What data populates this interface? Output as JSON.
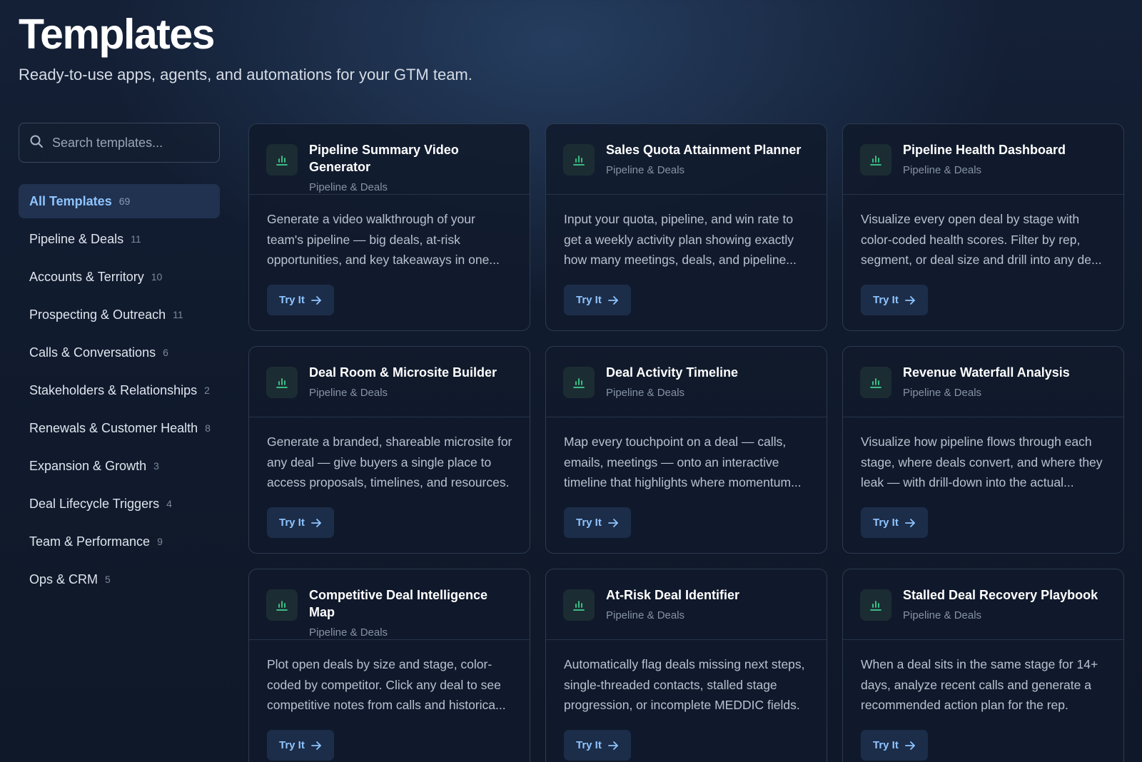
{
  "header": {
    "title": "Templates",
    "subtitle": "Ready-to-use apps, agents, and automations for your GTM team."
  },
  "search": {
    "placeholder": "Search templates...",
    "value": ""
  },
  "sidebar": {
    "items": [
      {
        "label": "All Templates",
        "count": "69",
        "active": true
      },
      {
        "label": "Pipeline & Deals",
        "count": "11"
      },
      {
        "label": "Accounts & Territory",
        "count": "10"
      },
      {
        "label": "Prospecting & Outreach",
        "count": "11"
      },
      {
        "label": "Calls & Conversations",
        "count": "6"
      },
      {
        "label": "Stakeholders & Relationships",
        "count": "2"
      },
      {
        "label": "Renewals & Customer Health",
        "count": "8"
      },
      {
        "label": "Expansion & Growth",
        "count": "3"
      },
      {
        "label": "Deal Lifecycle Triggers",
        "count": "4"
      },
      {
        "label": "Team & Performance",
        "count": "9"
      },
      {
        "label": "Ops & CRM",
        "count": "5"
      }
    ]
  },
  "cards": [
    {
      "title": "Pipeline Summary Video Generator",
      "category": "Pipeline & Deals",
      "description": "Generate a video walkthrough of your team's pipeline — big deals, at-risk opportunities, and key takeaways in one...",
      "button": "Try It"
    },
    {
      "title": "Sales Quota Attainment Planner",
      "category": "Pipeline & Deals",
      "description": "Input your quota, pipeline, and win rate to get a weekly activity plan showing exactly how many meetings, deals, and pipeline...",
      "button": "Try It"
    },
    {
      "title": "Pipeline Health Dashboard",
      "category": "Pipeline & Deals",
      "description": "Visualize every open deal by stage with color-coded health scores. Filter by rep, segment, or deal size and drill into any de...",
      "button": "Try It"
    },
    {
      "title": "Deal Room & Microsite Builder",
      "category": "Pipeline & Deals",
      "description": "Generate a branded, shareable microsite for any deal — give buyers a single place to access proposals, timelines, and resources.",
      "button": "Try It"
    },
    {
      "title": "Deal Activity Timeline",
      "category": "Pipeline & Deals",
      "description": "Map every touchpoint on a deal — calls, emails, meetings — onto an interactive timeline that highlights where momentum...",
      "button": "Try It"
    },
    {
      "title": "Revenue Waterfall Analysis",
      "category": "Pipeline & Deals",
      "description": "Visualize how pipeline flows through each stage, where deals convert, and where they leak — with drill-down into the actual...",
      "button": "Try It"
    },
    {
      "title": "Competitive Deal Intelligence Map",
      "category": "Pipeline & Deals",
      "description": "Plot open deals by size and stage, color-coded by competitor. Click any deal to see competitive notes from calls and historica...",
      "button": "Try It"
    },
    {
      "title": "At-Risk Deal Identifier",
      "category": "Pipeline & Deals",
      "description": "Automatically flag deals missing next steps, single-threaded contacts, stalled stage progression, or incomplete MEDDIC fields.",
      "button": "Try It"
    },
    {
      "title": "Stalled Deal Recovery Playbook",
      "category": "Pipeline & Deals",
      "description": "When a deal sits in the same stage for 14+ days, analyze recent calls and generate a recommended action plan for the rep.",
      "button": "Try It"
    }
  ],
  "icons": {
    "card": "bar-chart-icon",
    "search": "search-icon",
    "arrow": "arrow-right-icon"
  },
  "colors": {
    "accent": "#8fc4ff",
    "icon_green": "#3ecf8e",
    "background": "#111b2e"
  }
}
